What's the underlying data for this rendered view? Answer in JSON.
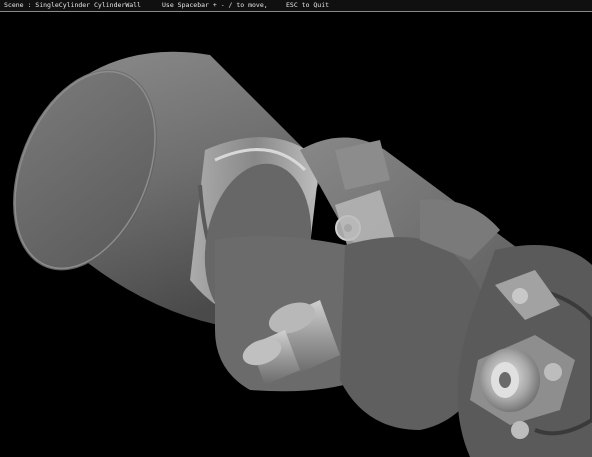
{
  "window": {
    "title_bar": {
      "scene_label": "Scene : SingleCylinder CylinderWall",
      "controls_hint": "Use Spacebar + - / to move,",
      "quit_hint": "ESC to Quit"
    }
  },
  "viewport": {
    "background": "#000000",
    "parts": [
      {
        "name": "cylinder-wall",
        "color": "#707070"
      },
      {
        "name": "piston-rings",
        "color": "#9a9a9a"
      },
      {
        "name": "connecting-rod",
        "color": "#787878"
      },
      {
        "name": "crank-web",
        "color": "#6e6e6e"
      },
      {
        "name": "crankshaft-pin",
        "color": "#a0a0a0"
      },
      {
        "name": "flywheel-hub",
        "color": "#c0c0c0"
      }
    ]
  }
}
